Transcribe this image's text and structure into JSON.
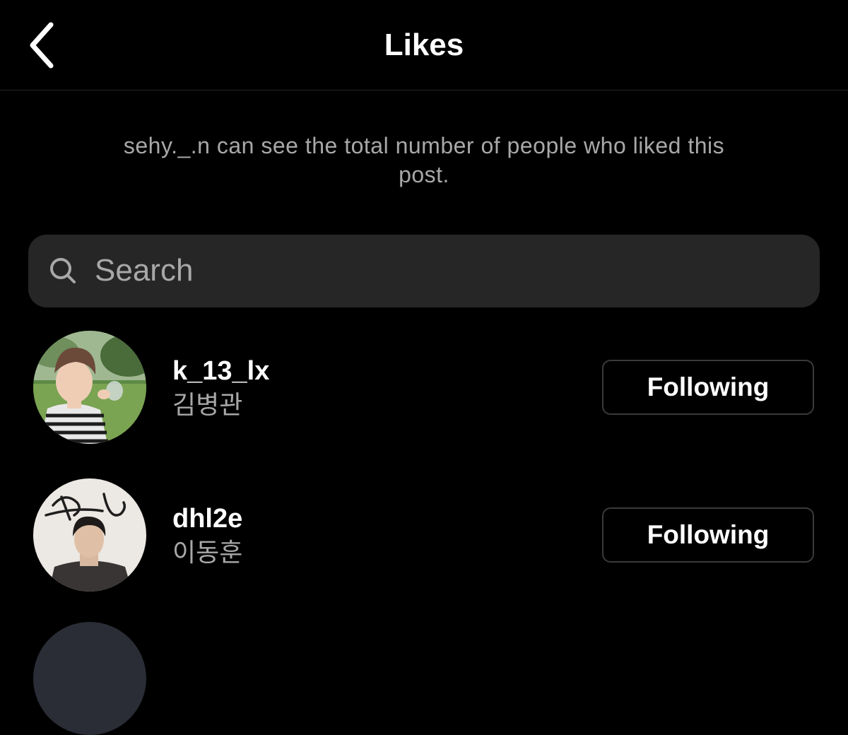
{
  "header": {
    "title": "Likes",
    "back_icon": "chevron-left-icon"
  },
  "notice": {
    "text": "sehy._.n can see the total number of people who liked this post."
  },
  "search": {
    "placeholder": "Search",
    "value": "",
    "icon": "search-icon"
  },
  "likes": [
    {
      "username": "k_13_lx",
      "full_name": "김병관",
      "button_label": "Following",
      "avatar_icon": "profile-photo"
    },
    {
      "username": "dhl2e",
      "full_name": "이동훈",
      "button_label": "Following",
      "avatar_icon": "profile-photo-signed"
    }
  ],
  "colors": {
    "background": "#000000",
    "text_primary": "#ffffff",
    "text_secondary": "#a8a8a8",
    "search_bg": "#262626",
    "button_border": "#3a3a3a"
  }
}
